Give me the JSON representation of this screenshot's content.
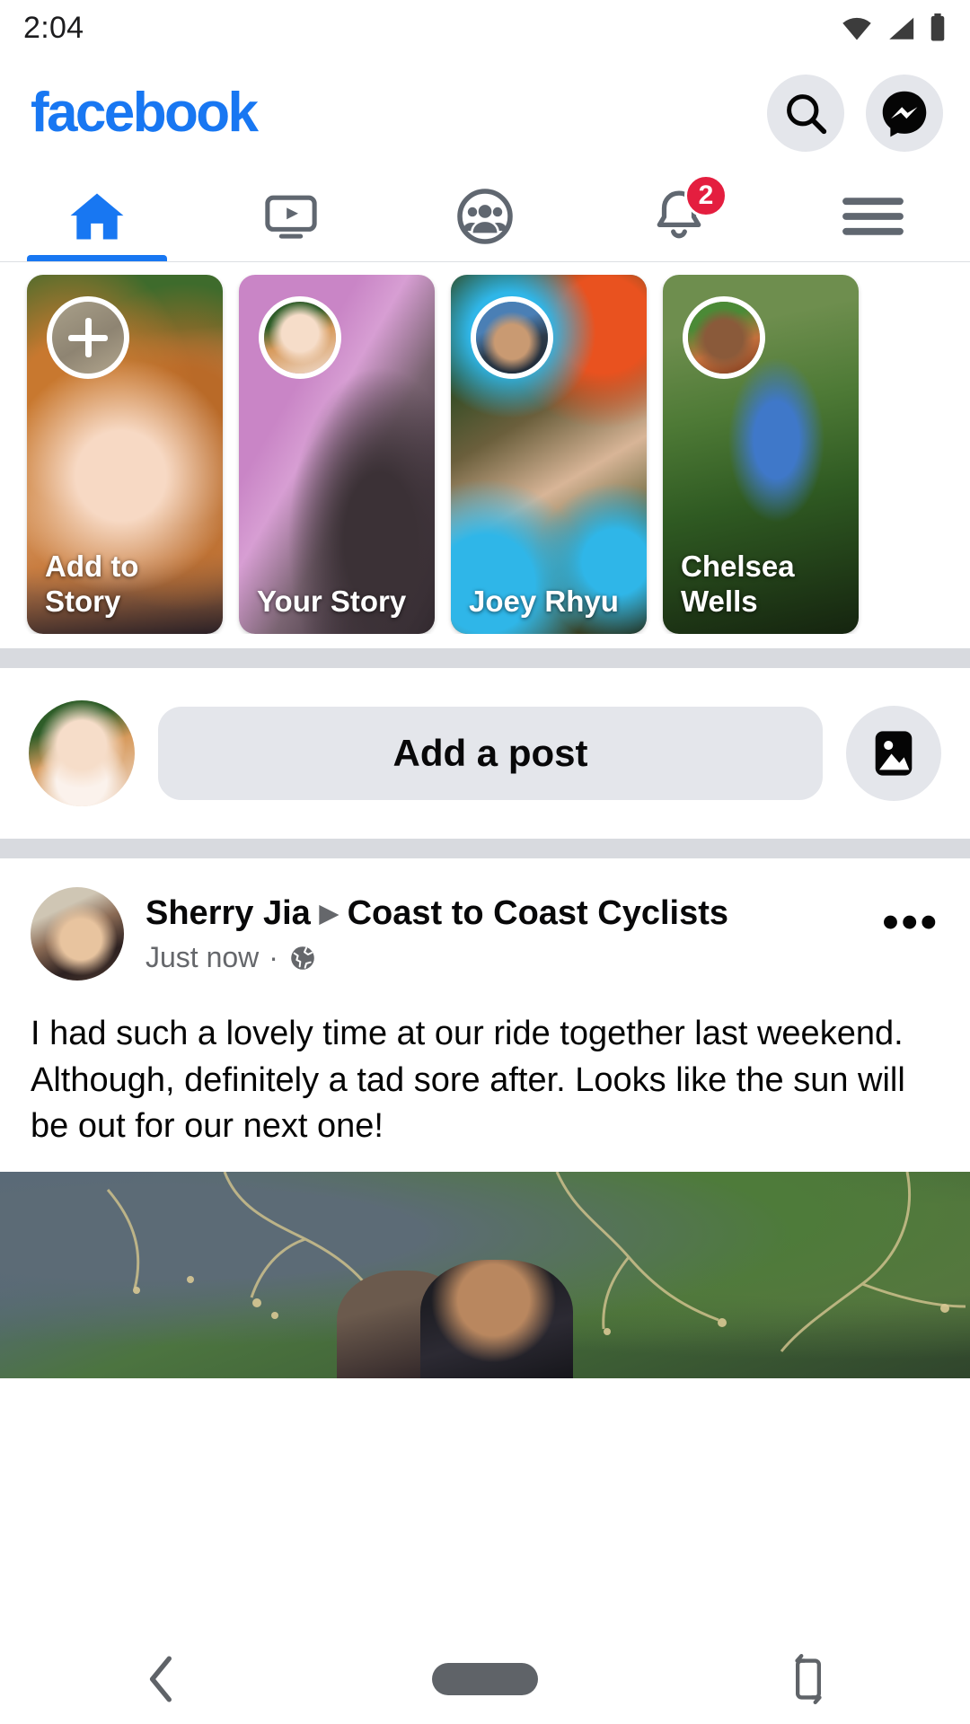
{
  "status_bar": {
    "time": "2:04",
    "icons": [
      "wifi-icon",
      "cellular-signal-icon",
      "battery-icon"
    ]
  },
  "header": {
    "logo_text": "facebook",
    "logo_color": "#1877F2",
    "actions": [
      {
        "name": "search-button",
        "icon": "search-icon"
      },
      {
        "name": "messenger-button",
        "icon": "messenger-icon"
      }
    ]
  },
  "tabs": [
    {
      "name": "tab-home",
      "icon": "home-icon",
      "active": true,
      "badge": ""
    },
    {
      "name": "tab-watch",
      "icon": "watch-video-icon",
      "active": false,
      "badge": ""
    },
    {
      "name": "tab-groups",
      "icon": "groups-icon",
      "active": false,
      "badge": ""
    },
    {
      "name": "tab-notifications",
      "icon": "bell-icon",
      "active": false,
      "badge": "2"
    },
    {
      "name": "tab-menu",
      "icon": "hamburger-menu-icon",
      "active": false,
      "badge": ""
    }
  ],
  "active_tab_color": "#1877F2",
  "badge_color": "#E41E3F",
  "stories": [
    {
      "label": "Add to Story",
      "type": "add",
      "avatar_icon": "plus-icon"
    },
    {
      "label": "Your Story",
      "type": "story",
      "avatar_icon": "profile-avatar"
    },
    {
      "label": "Joey Rhyu",
      "type": "story",
      "avatar_icon": "profile-avatar"
    },
    {
      "label": "Chelsea Wells",
      "type": "story",
      "avatar_icon": "profile-avatar"
    }
  ],
  "composer": {
    "avatar_name": "user-avatar",
    "placeholder": "Add a post",
    "photo_button_icon": "photo-icon"
  },
  "post": {
    "author": "Sherry Jia",
    "separator_icon": "triangle-right-icon",
    "group": "Coast to Coast Cyclists",
    "timestamp": "Just now",
    "dot": "·",
    "audience_icon": "globe-icon",
    "more_label": "•••",
    "body": "I had such a lovely time at our ride together last weekend. Although, definitely a tad sore after. Looks like the sun will be out for our next one!",
    "photo_name": "post-photo"
  },
  "system_nav": [
    {
      "name": "nav-back-button",
      "icon": "back-chevron-icon"
    },
    {
      "name": "nav-home-button",
      "icon": "home-pill-icon"
    },
    {
      "name": "nav-rotate-button",
      "icon": "screen-rotate-icon"
    }
  ]
}
